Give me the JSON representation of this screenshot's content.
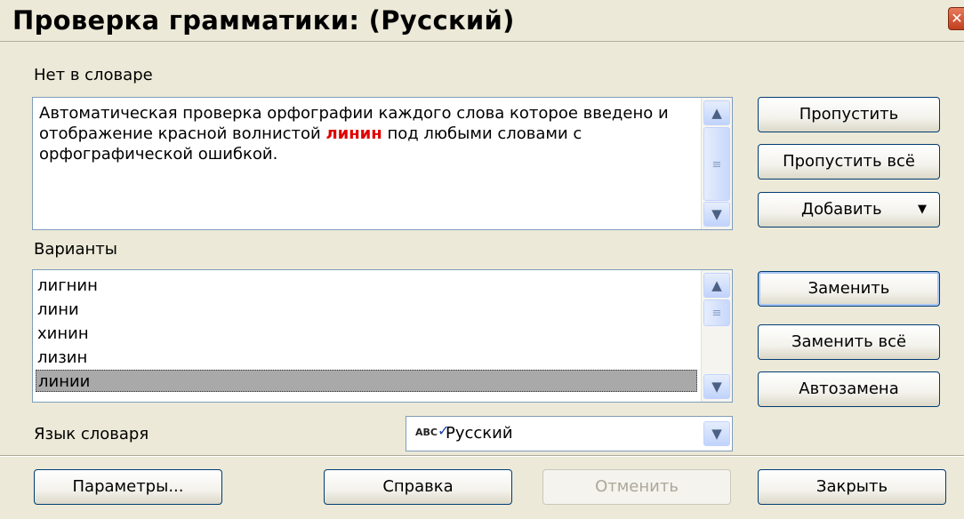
{
  "window": {
    "title": "Проверка грамматики: (Русский)",
    "close_glyph": "✕"
  },
  "not_in_dictionary": {
    "label": "Нет в словаре",
    "text_before": "Автоматическая проверка орфографии каждого слова которое введено и отображение красной волнистой ",
    "error_word": "линин",
    "text_after": " под любыми словами с орфографической ошибкой."
  },
  "suggestions": {
    "label": "Варианты",
    "items": [
      "лигнин",
      "лини",
      "хинин",
      "лизин",
      "линии"
    ],
    "selected_index": 4
  },
  "dictionary_language": {
    "label": "Язык словаря",
    "value": "Русский",
    "icon_text": "ABC"
  },
  "buttons": {
    "ignore": "Пропустить",
    "ignore_all": "Пропустить всё",
    "add": "Добавить",
    "replace": "Заменить",
    "replace_all": "Заменить всё",
    "autocorrect": "Автозамена",
    "options": "Параметры...",
    "help": "Справка",
    "undo": "Отменить",
    "close": "Закрыть"
  },
  "icons": {
    "scroll_up": "▲",
    "scroll_down": "▼",
    "dropdown": "▼",
    "thumb_grip": "≡"
  },
  "colors": {
    "error": "#e00000",
    "selection": "#a9a9a9",
    "dialog_bg": "#ece9d8"
  }
}
